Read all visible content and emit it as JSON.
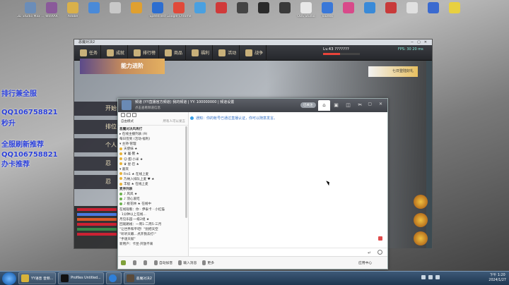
{
  "desktop": {
    "icons": [
      "3D Studio Max ...",
      "WinRAR",
      "Adobe",
      "",
      "",
      "",
      "SpeedTest",
      "Google Chrome",
      "",
      "",
      "",
      "",
      "",
      "OBS Studio",
      "ToDesk",
      "",
      "",
      "",
      "",
      "",
      ""
    ],
    "side_text": [
      "排行兼全服",
      "QQ106758821",
      "秒升",
      "全服刷新推荐",
      "QQ106758821",
      "办卡推荐"
    ]
  },
  "game": {
    "window_title": "恶魔对决2",
    "nav": [
      "任务",
      "成就",
      "排行榜",
      "商品",
      "福利",
      "活动",
      "战争"
    ],
    "level": "Lv.43",
    "level_value": "???????",
    "exp_fraction": 0.46,
    "fps": "FPS: 30   20 ms",
    "banner": "能力进阶",
    "menu": [
      "开始",
      "排位",
      "个人",
      "忍",
      "忍"
    ],
    "event": "七日登陆好礼"
  },
  "yy": {
    "title": "频道 (YY直播官方频道) 我的频道 | YY: 100000000 | 频道设置",
    "subtitle": "点击查看频道信息",
    "pill": "已关注",
    "tabs": [
      "⌂",
      "▣",
      "◫",
      "✂"
    ],
    "window_controls": "− ▢ ✕",
    "left_mode": "自由模式",
    "left_mode_right": "所有人可以发言",
    "tree": [
      {
        "text": "恶魔对决风再打",
        "bold": true,
        "dot": false
      },
      {
        "text": "▸ 在线主播列表 (9)",
        "bold": false,
        "dot": false
      },
      {
        "text": "每日签到 (活动·福利)",
        "bold": false,
        "dot": false
      },
      {
        "text": "▾ 主持·管理",
        "bold": false,
        "dot": false
      },
      {
        "text": "天使妹 ★",
        "bold": false,
        "dot": true
      },
      {
        "text": "♛ 屠·鳌 ★",
        "bold": false,
        "dot": true
      },
      {
        "text": "☺ 甜·小米 ★",
        "bold": false,
        "dot": true
      },
      {
        "text": "♛ 星·巴 ★",
        "bold": false,
        "dot": true
      },
      {
        "text": "▾ 嘉宾",
        "bold": false,
        "dot": false
      },
      {
        "text": "Fre1 ★ 在线上麦",
        "bold": false,
        "dot": true
      },
      {
        "text": "乃纳入排队上麦 ♥ ★",
        "bold": false,
        "dot": true
      },
      {
        "text": "丰极 ★ 在线上麦",
        "bold": false,
        "dot": true
      },
      {
        "text": "麦序列表",
        "bold": true,
        "dot": false
      },
      {
        "text": "♪ 风岚 ★",
        "bold": false,
        "dot": true,
        "green": true
      },
      {
        "text": "♪ 羽心爱吃",
        "bold": false,
        "dot": true,
        "green": true
      },
      {
        "text": "♪ 桃花林 ★ 在线中",
        "bold": false,
        "dot": true,
        "green": true
      },
      {
        "text": "在线观看：你 · 伊泰卡 · 小红猫",
        "bold": false,
        "dot": false
      },
      {
        "text": "· 1分钟以上在线...",
        "bold": false,
        "dot": false
      },
      {
        "text": "月见乐园·一级2组 ★",
        "bold": false,
        "dot": false
      },
      {
        "text": "回观路线：一周1·二周5·三月",
        "bold": false,
        "dot": false
      },
      {
        "text": "\"让世界和平吧！\"别把天空",
        "bold": false,
        "dot": false
      },
      {
        "text": "\"听听天籁…点开我去打!\"",
        "bold": false,
        "dot": false
      },
      {
        "text": "\"手速天赋\"",
        "bold": false,
        "dot": false
      },
      {
        "text": "新用户：卡昆·开放不来",
        "bold": false,
        "dot": false
      }
    ],
    "message": "通知：你的帐号已通过直播认证，你可以随意发言。",
    "input_send": "↵",
    "footer": [
      "自动加音",
      "输入消息",
      "更多"
    ],
    "apply": "应用中心"
  },
  "taskbar": {
    "items": [
      "YY语音 音频...",
      "Profiles Untitled...",
      "",
      "恶魔对决2"
    ],
    "time": "下午 1:20",
    "date": "2024/1/27"
  }
}
